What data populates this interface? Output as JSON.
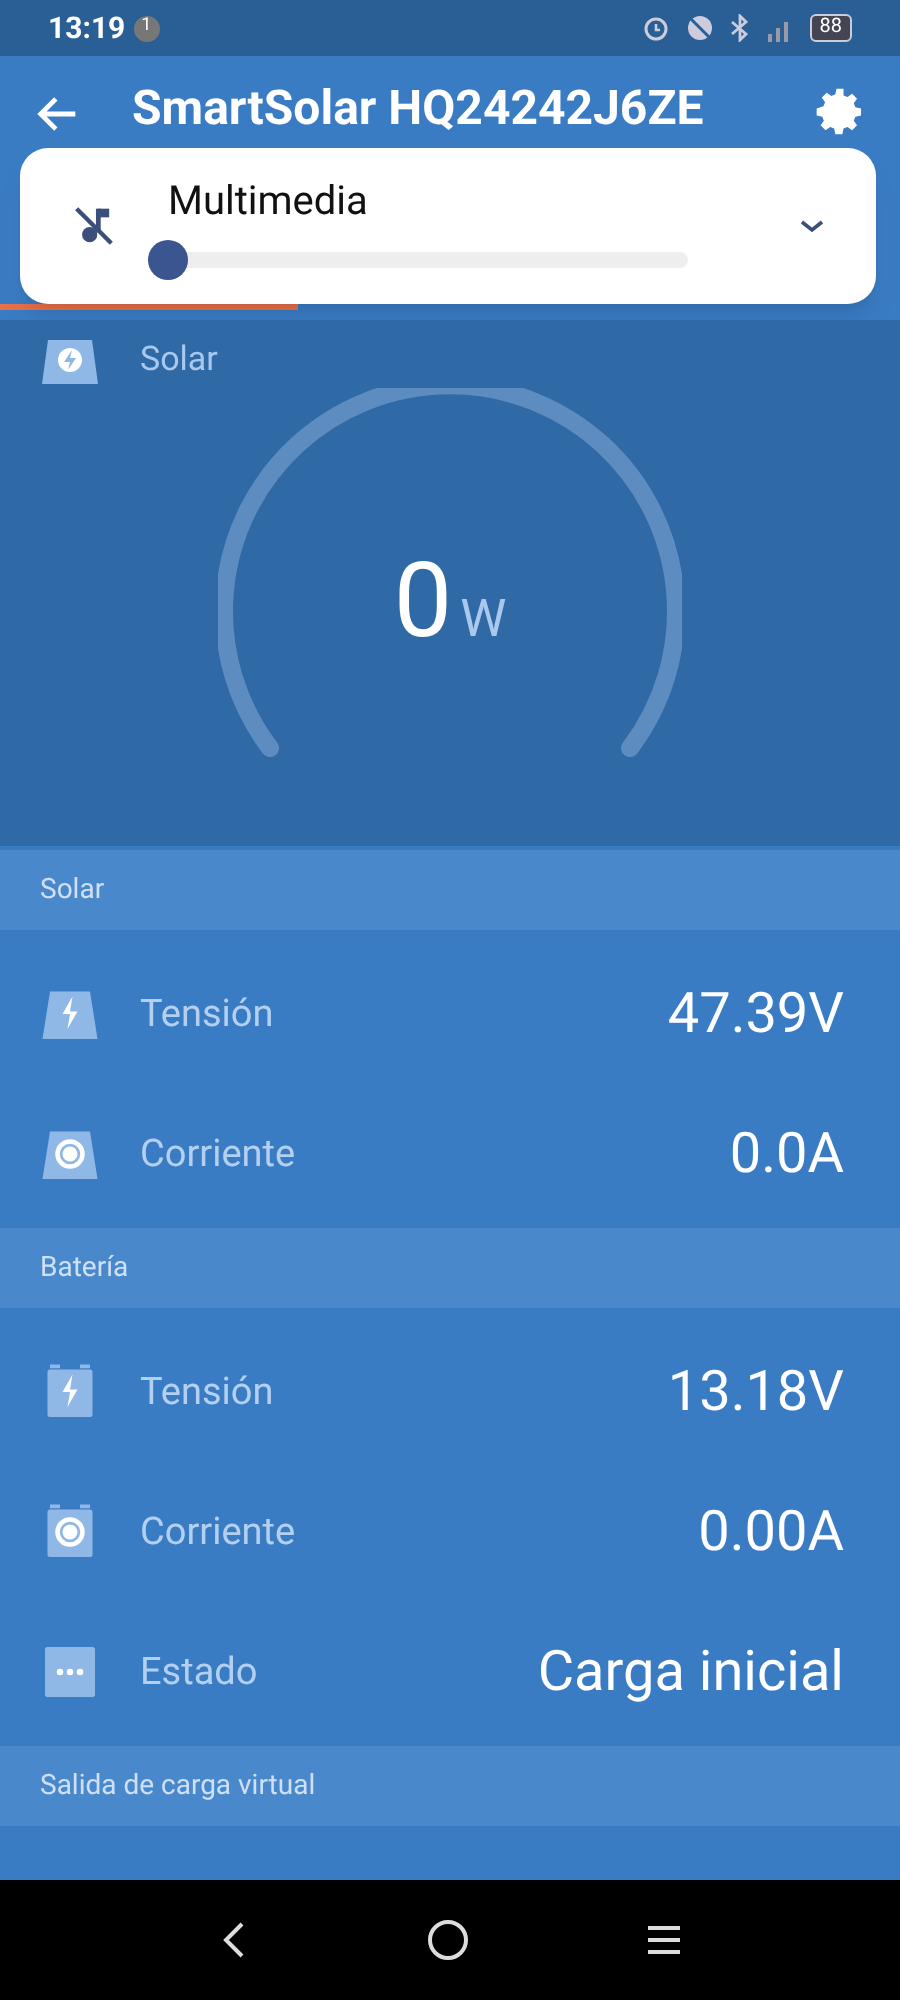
{
  "status_bar": {
    "time": "13:19",
    "notification_count": "1",
    "battery": "88"
  },
  "app_bar": {
    "title": "SmartSolar HQ24242J6ZE",
    "progress": {
      "level": 0.33
    }
  },
  "volume_popup": {
    "label": "Multimedia",
    "muted": true,
    "slider": {
      "level": 0
    }
  },
  "gauge": {
    "label": "Solar",
    "value": "0",
    "unit": "W"
  },
  "sections": [
    {
      "title": "Solar",
      "kind": "solar",
      "rows": [
        {
          "kind": "voltage",
          "label": "Tensión",
          "value": "47.39V"
        },
        {
          "kind": "current",
          "label": "Corriente",
          "value": "0.0A"
        }
      ]
    },
    {
      "title": "Batería",
      "kind": "battery",
      "rows": [
        {
          "kind": "voltage",
          "label": "Tensión",
          "value": "13.18V"
        },
        {
          "kind": "current",
          "label": "Corriente",
          "value": "0.00A"
        },
        {
          "kind": "status",
          "label": "Estado",
          "value": "Carga inicial"
        }
      ]
    },
    {
      "title": "Salida de carga virtual"
    }
  ]
}
